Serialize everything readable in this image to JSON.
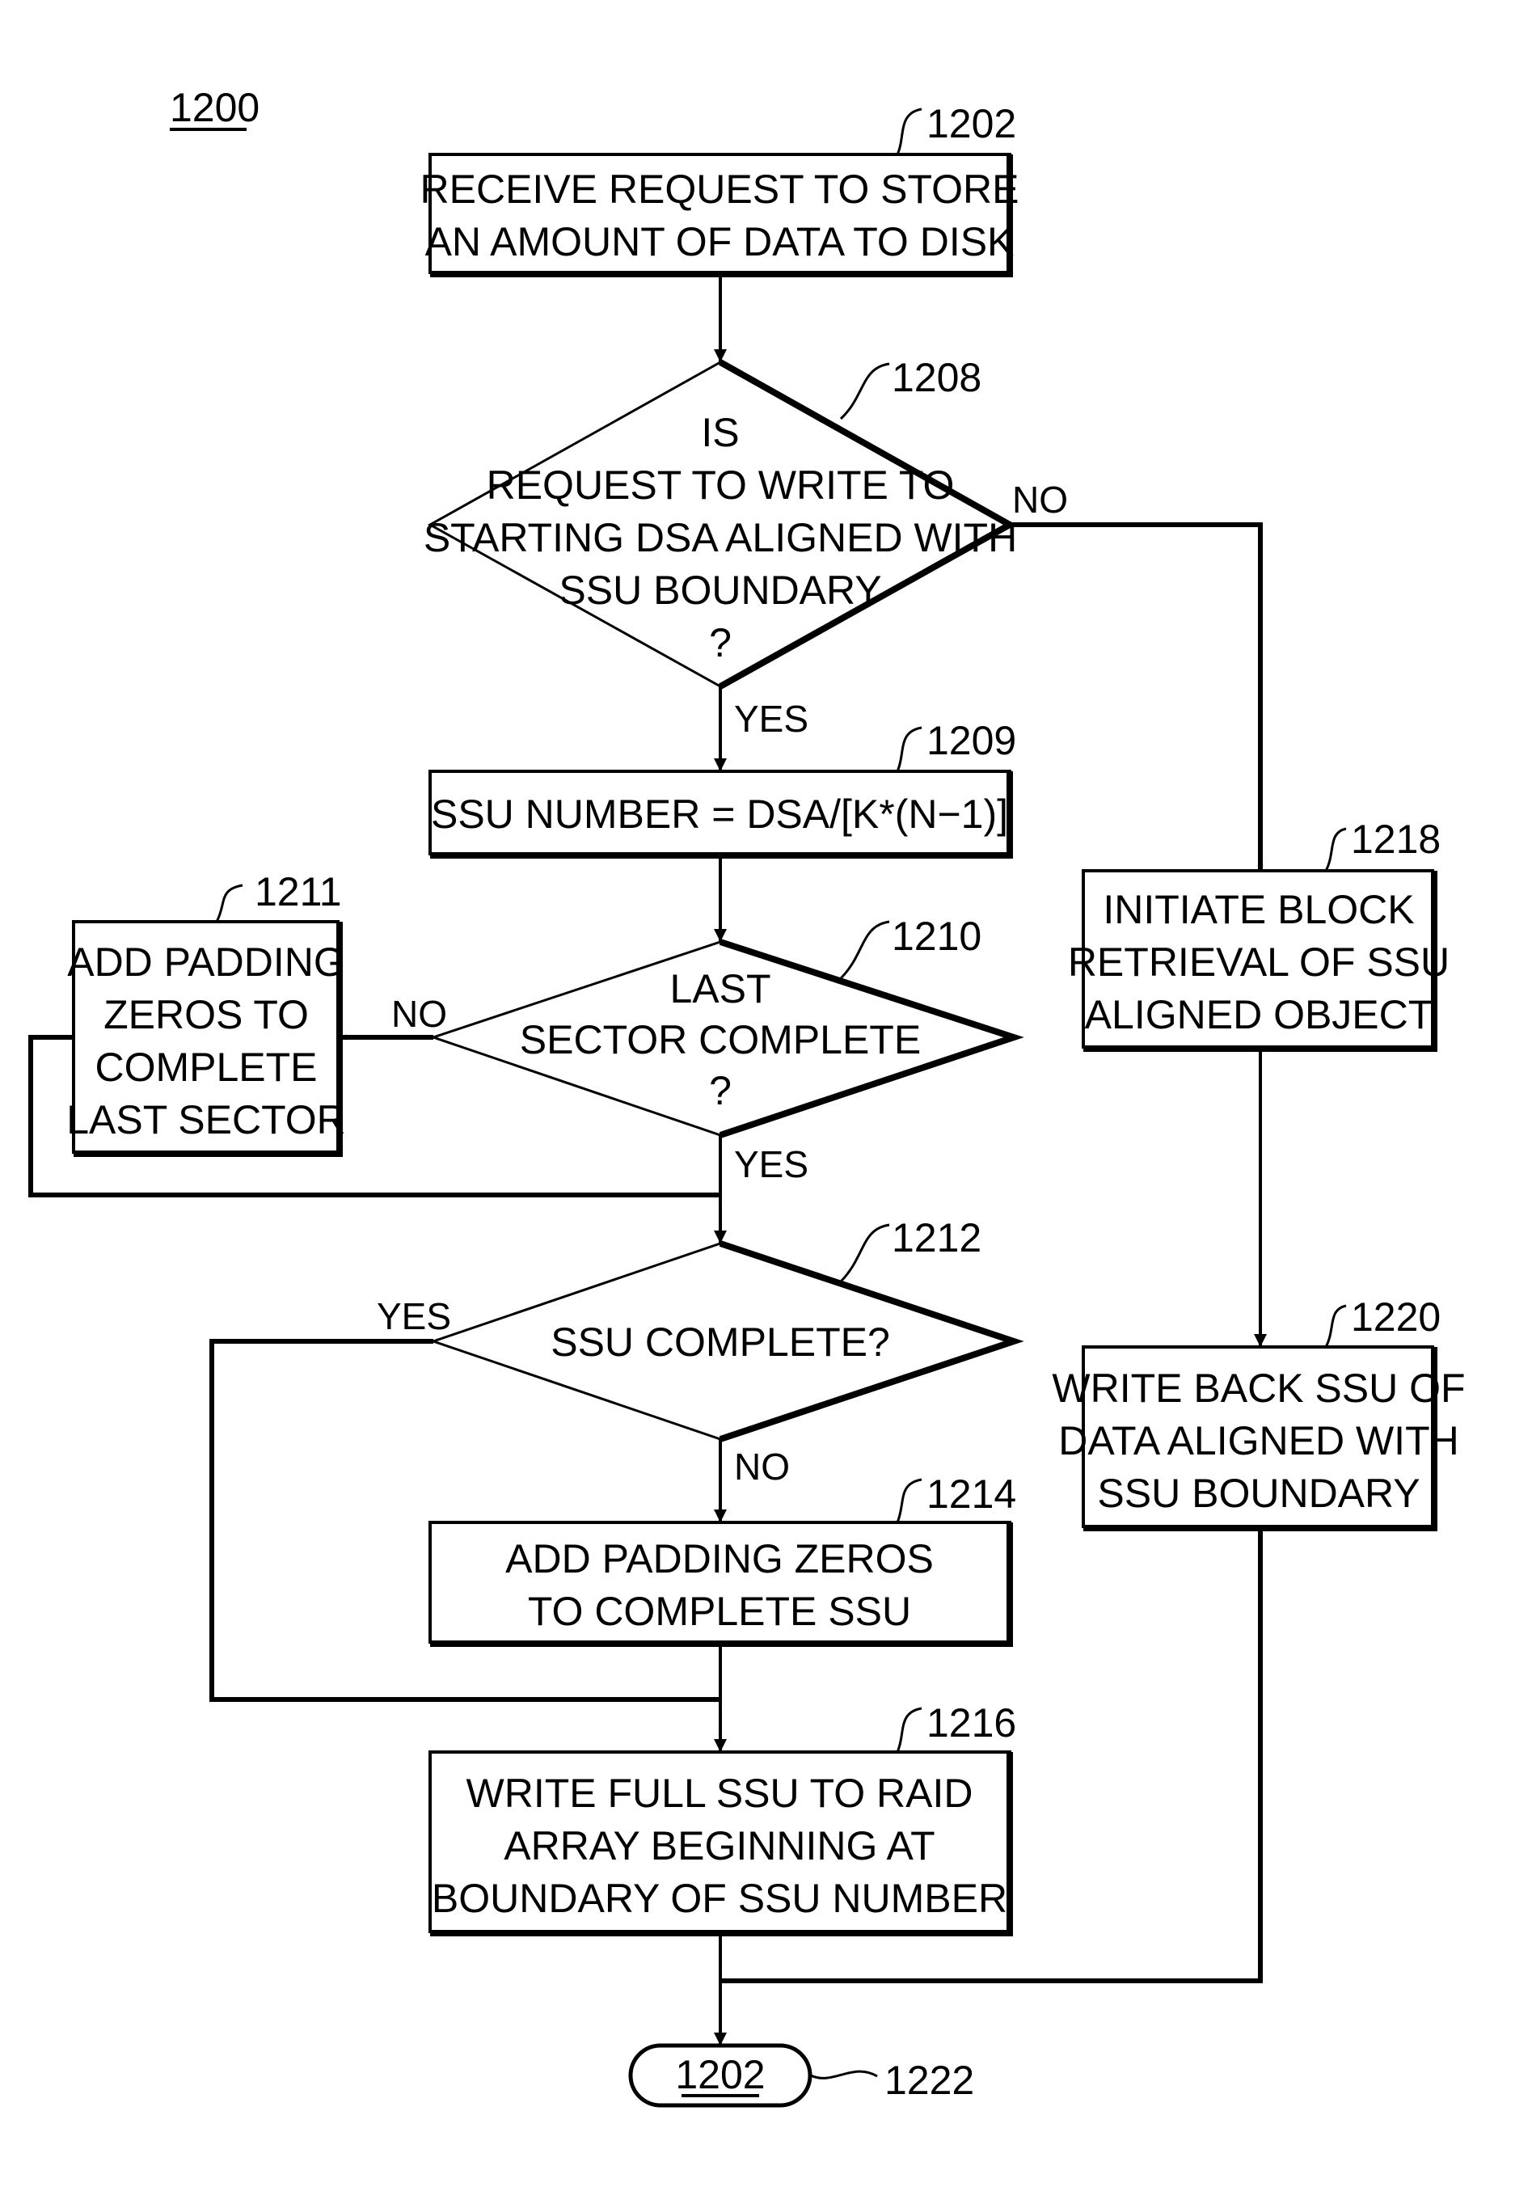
{
  "figure": {
    "ref": "1200",
    "colors": {
      "ink": "#000000",
      "background": "#ffffff"
    }
  },
  "nodes": {
    "n1202": {
      "ref": "1202",
      "lines": [
        "RECEIVE REQUEST TO STORE",
        "AN AMOUNT OF DATA TO DISK"
      ]
    },
    "n1208": {
      "ref": "1208",
      "lines": [
        "IS",
        "REQUEST TO WRITE TO",
        "STARTING DSA ALIGNED WITH",
        "SSU BOUNDARY",
        "?"
      ]
    },
    "n1209": {
      "ref": "1209",
      "lines": [
        "SSU NUMBER = DSA/[K*(N−1)]"
      ]
    },
    "n1210": {
      "ref": "1210",
      "lines": [
        "LAST",
        "SECTOR COMPLETE",
        "?"
      ]
    },
    "n1211": {
      "ref": "1211",
      "lines": [
        "ADD PADDING",
        "ZEROS TO",
        "COMPLETE",
        "LAST SECTOR"
      ]
    },
    "n1212": {
      "ref": "1212",
      "lines": [
        "SSU COMPLETE?"
      ]
    },
    "n1214": {
      "ref": "1214",
      "lines": [
        "ADD PADDING ZEROS",
        "TO COMPLETE SSU"
      ]
    },
    "n1216": {
      "ref": "1216",
      "lines": [
        "WRITE FULL SSU TO RAID",
        "ARRAY BEGINNING AT",
        "BOUNDARY OF SSU NUMBER"
      ]
    },
    "n1218": {
      "ref": "1218",
      "lines": [
        "INITIATE BLOCK",
        "RETRIEVAL OF SSU",
        "ALIGNED OBJECT"
      ]
    },
    "n1220": {
      "ref": "1220",
      "lines": [
        "WRITE BACK SSU OF",
        "DATA ALIGNED WITH",
        "SSU BOUNDARY"
      ]
    },
    "n1222": {
      "ref": "1222",
      "lines": [
        "1202"
      ]
    }
  },
  "edges": {
    "e1208_no": "NO",
    "e1208_yes": "YES",
    "e1210_no": "NO",
    "e1210_yes": "YES",
    "e1212_yes": "YES",
    "e1212_no": "NO"
  }
}
